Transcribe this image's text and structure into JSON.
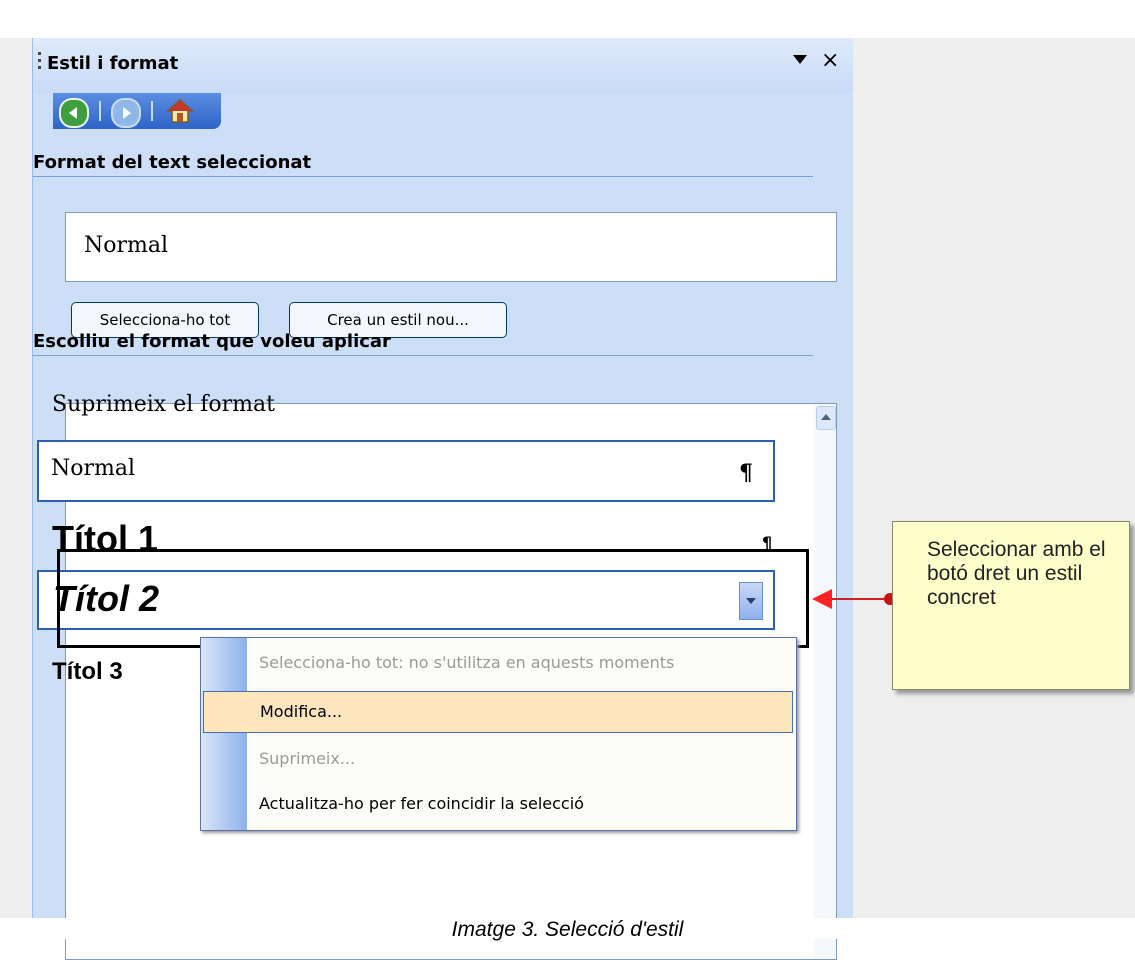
{
  "pane": {
    "title": "Estil i format",
    "nav": {
      "back_icon": "back-arrow-icon",
      "forward_icon": "forward-arrow-icon",
      "home_icon": "home-icon"
    }
  },
  "current_format": {
    "heading": "Format del text seleccionat",
    "value": "Normal",
    "select_all_label": "Selecciona-ho tot",
    "new_style_label": "Crea un estil nou..."
  },
  "apply_format": {
    "heading": "Escolliu el format que voleu aplicar",
    "items": [
      {
        "label": "Suprimeix el format"
      },
      {
        "label": "Normal",
        "mark": "¶"
      },
      {
        "label": "Títol 1",
        "mark": "¶"
      },
      {
        "label": "Títol 2"
      },
      {
        "label": "Títol 3"
      }
    ]
  },
  "context_menu": {
    "items": [
      {
        "label": "Selecciona-ho tot: no s'utilitza en aquests moments",
        "enabled": false
      },
      {
        "label": "Modifica...",
        "enabled": true,
        "highlighted": true
      },
      {
        "label": "Suprimeix...",
        "enabled": false
      },
      {
        "label": "Actualitza-ho per fer coincidir la selecció",
        "enabled": true
      }
    ]
  },
  "callout": {
    "text": "Seleccionar amb el botó dret un estil concret"
  },
  "caption": "Imatge 3. Selecció d'estil",
  "colors": {
    "pane_bg": "#cddff7",
    "menu_highlight": "#fde5bd",
    "callout_bg": "#ffffcc",
    "arrow": "#ff2222"
  }
}
